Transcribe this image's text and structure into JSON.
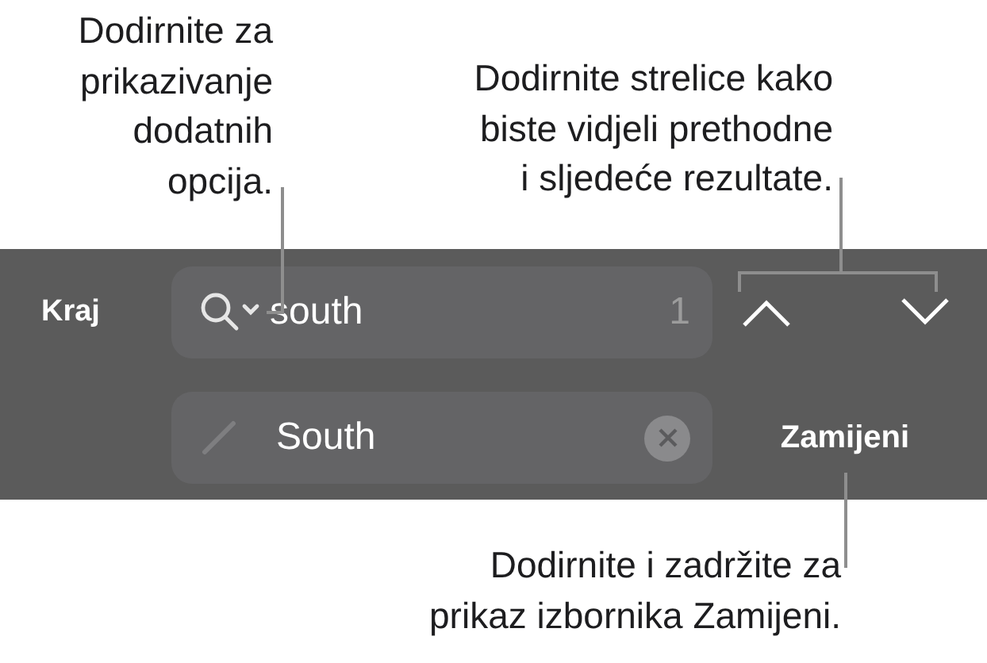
{
  "callouts": [
    {
      "lines": [
        "Dodirnite za",
        "prikazivanje",
        "dodatnih",
        "opcija."
      ]
    },
    {
      "lines": [
        "Dodirnite strelice kako",
        "biste vidjeli prethodne",
        "i sljedeće rezultate."
      ]
    },
    {
      "lines": [
        "Dodirnite i zadržite za",
        "prikaz izbornika Zamijeni."
      ]
    }
  ],
  "find_bar": {
    "done_button": "Kraj",
    "search_field": {
      "value": "south",
      "match_count": "1"
    },
    "replace_field": {
      "value": "South"
    },
    "replace_button": "Zamijeni"
  }
}
